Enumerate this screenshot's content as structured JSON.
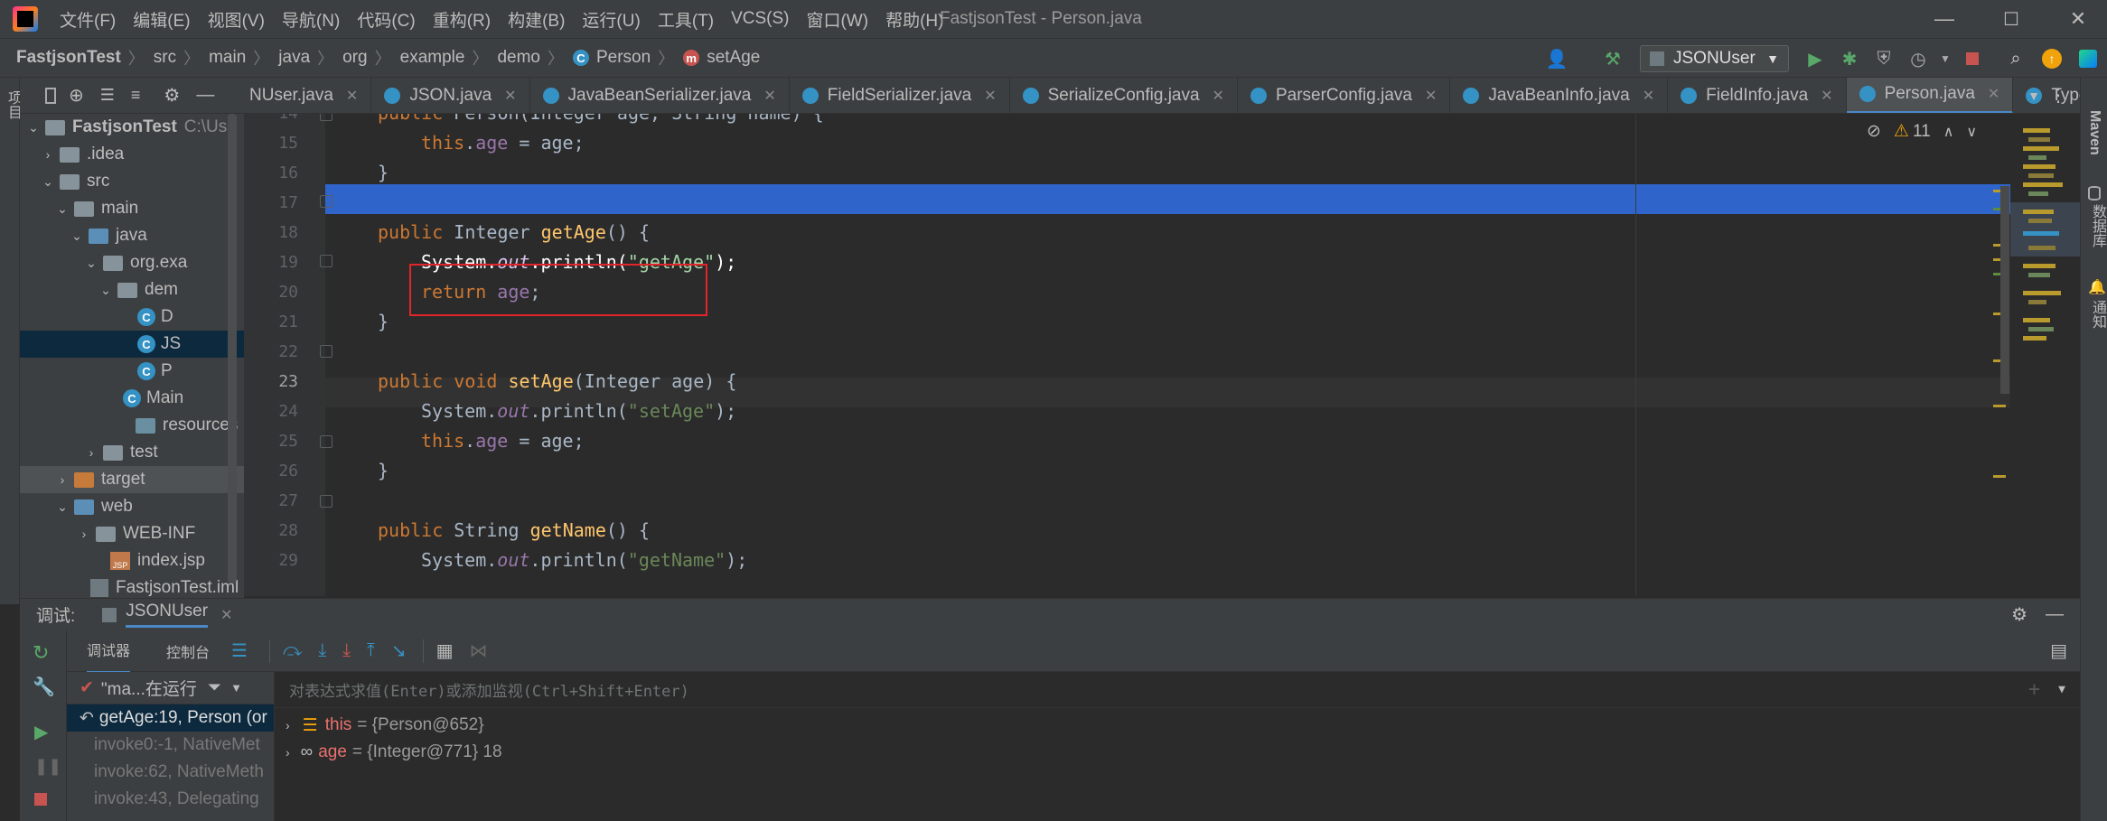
{
  "window": {
    "title": "FastjsonTest - Person.java",
    "menu": [
      "文件(F)",
      "编辑(E)",
      "视图(V)",
      "导航(N)",
      "代码(C)",
      "重构(R)",
      "构建(B)",
      "运行(U)",
      "工具(T)",
      "VCS(S)",
      "窗口(W)",
      "帮助(H)"
    ]
  },
  "breadcrumb": [
    "FastjsonTest",
    "src",
    "main",
    "java",
    "org",
    "example",
    "demo",
    "Person",
    "setAge"
  ],
  "toolbar": {
    "run_config": "JSONUser"
  },
  "strips": {
    "left": "项目",
    "right_top": "Maven",
    "right_mid": "数据库",
    "right_bottom": "通知"
  },
  "project_tree": [
    {
      "label": "FastjsonTest",
      "extra": "C:\\Use"
    },
    {
      "label": ".idea"
    },
    {
      "label": "src"
    },
    {
      "label": "main"
    },
    {
      "label": "java"
    },
    {
      "label": "org.exa"
    },
    {
      "label": "dem"
    },
    {
      "label": "D"
    },
    {
      "label": "JS"
    },
    {
      "label": "P"
    },
    {
      "label": "Main"
    },
    {
      "label": "resources"
    },
    {
      "label": "test"
    },
    {
      "label": "target"
    },
    {
      "label": "web"
    },
    {
      "label": "WEB-INF"
    },
    {
      "label": "index.jsp"
    },
    {
      "label": "FastjsonTest.iml"
    }
  ],
  "tabs": [
    "NUser.java",
    "JSON.java",
    "JavaBeanSerializer.java",
    "FieldSerializer.java",
    "SerializeConfig.java",
    "ParserConfig.java",
    "JavaBeanInfo.java",
    "FieldInfo.java",
    "Person.java",
    "TypeUt"
  ],
  "editor": {
    "line_numbers": [
      "14",
      "15",
      "16",
      "17",
      "18",
      "19",
      "20",
      "21",
      "22",
      "23",
      "24",
      "25",
      "26",
      "27",
      "28",
      "29"
    ],
    "warnings": "11",
    "code": {
      "l14": [
        "public ",
        "Person",
        "(",
        "Integer",
        " age, ",
        "String",
        " name) {"
      ],
      "l15": [
        "this",
        ".",
        "age",
        " = age;"
      ],
      "l16": [
        "}"
      ],
      "l18": [
        "public ",
        "Integer ",
        "getAge",
        "() {"
      ],
      "l19": [
        "System.",
        "out",
        ".println(",
        "\"getAge\"",
        ");"
      ],
      "l20": [
        "return ",
        "age",
        ";"
      ],
      "l21": [
        "}"
      ],
      "l23": [
        "public void ",
        "setAge",
        "(Integer age) {"
      ],
      "l24": [
        "System.",
        "out",
        ".println(",
        "\"setAge\"",
        ");"
      ],
      "l25": [
        "this",
        ".",
        "age",
        " = age;"
      ],
      "l26": [
        "}"
      ],
      "l28": [
        "public ",
        "String ",
        "getName",
        "() {"
      ],
      "l29": [
        "System.",
        "out",
        ".println(",
        "\"getName\"",
        ");"
      ]
    }
  },
  "debug": {
    "label": "调试:",
    "session": "JSONUser",
    "tab_debugger": "调试器",
    "tab_console": "控制台",
    "thread": "\"ma...在运行",
    "eval_placeholder": "对表达式求值(Enter)或添加监视(Ctrl+Shift+Enter)",
    "frames": [
      "getAge:19, Person (or",
      "invoke0:-1, NativeMet",
      "invoke:62, NativeMeth",
      "invoke:43, Delegating"
    ],
    "vars": [
      {
        "name": "this",
        "value": "= {Person@652}"
      },
      {
        "name": "age",
        "value": "= {Integer@771} 18"
      }
    ]
  }
}
